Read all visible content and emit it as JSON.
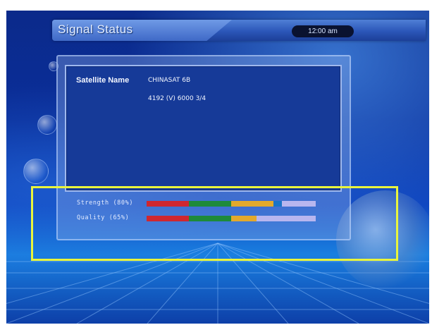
{
  "window": {
    "title": "Signal Status",
    "clock": "12:00 am"
  },
  "info": {
    "satellite_label": "Satellite Name",
    "satellite_value": "CHINASAT 6B",
    "transponder": "4192 (V) 6000 3/4"
  },
  "signal": {
    "strength": {
      "label": "Strength (80%)",
      "percent": 80
    },
    "quality": {
      "label": "Quality (65%)",
      "percent": 65
    }
  },
  "colors": {
    "bar_red": "#cf2730",
    "bar_green": "#1e8a3a",
    "bar_yellow": "#e3a92c",
    "bar_blue": "#1a74c8",
    "bar_track": "#b8b6ef",
    "highlight": "#e9f53c"
  }
}
